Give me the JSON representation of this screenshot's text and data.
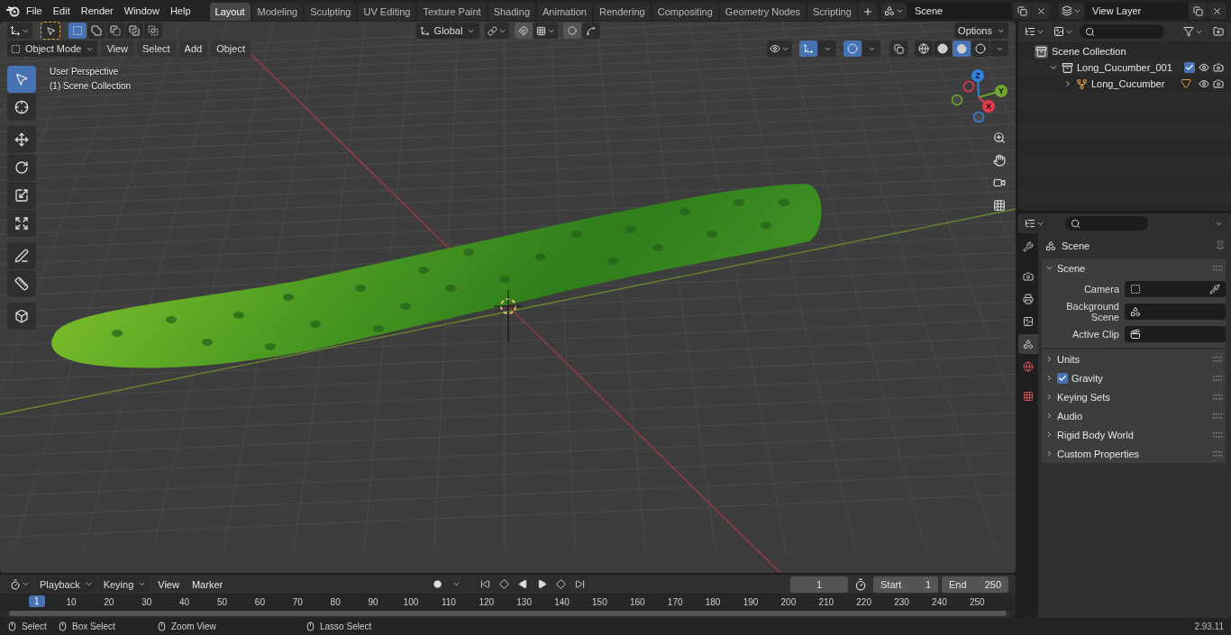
{
  "app_menu": [
    "File",
    "Edit",
    "Render",
    "Window",
    "Help"
  ],
  "workspaces": [
    {
      "label": "Layout",
      "selected": true
    },
    {
      "label": "Modeling",
      "selected": false
    },
    {
      "label": "Sculpting",
      "selected": false
    },
    {
      "label": "UV Editing",
      "selected": false
    },
    {
      "label": "Texture Paint",
      "selected": false
    },
    {
      "label": "Shading",
      "selected": false
    },
    {
      "label": "Animation",
      "selected": false
    },
    {
      "label": "Rendering",
      "selected": false
    },
    {
      "label": "Compositing",
      "selected": false
    },
    {
      "label": "Geometry Nodes",
      "selected": false
    },
    {
      "label": "Scripting",
      "selected": false
    }
  ],
  "scene_selector": {
    "value": "Scene"
  },
  "view_layer_selector": {
    "value": "View Layer"
  },
  "viewport": {
    "select_modes": [
      {
        "kind": "new",
        "selected": true
      },
      {
        "kind": "extend",
        "selected": false
      },
      {
        "kind": "subtract",
        "selected": false
      },
      {
        "kind": "invert",
        "selected": false
      },
      {
        "kind": "intersect",
        "selected": false
      }
    ],
    "orientation": "Global",
    "options": "Options",
    "mode": "Object Mode",
    "menus": [
      "View",
      "Select",
      "Add",
      "Object"
    ],
    "gizmos": {
      "on": true
    },
    "overlays": {
      "on": true
    },
    "xray": {
      "on": false
    },
    "shading": [
      {
        "kind": "wireframe",
        "selected": false
      },
      {
        "kind": "solid",
        "selected": false
      },
      {
        "kind": "material",
        "selected": true
      },
      {
        "kind": "rendered",
        "selected": false
      }
    ],
    "info": [
      "User Perspective",
      "(1) Scene Collection"
    ],
    "tools": [
      {
        "kind": "select",
        "selected": true
      },
      {
        "kind": "cursor",
        "selected": false
      },
      {
        "kind": "move",
        "selected": false
      },
      {
        "kind": "rotate",
        "selected": false
      },
      {
        "kind": "scale",
        "selected": false
      },
      {
        "kind": "transform",
        "selected": false
      },
      {
        "kind": "annotate",
        "selected": false
      },
      {
        "kind": "measure",
        "selected": false
      },
      {
        "kind": "add-cube",
        "selected": false
      }
    ],
    "gizmo": [
      {
        "label": "Z",
        "color": "#2f83e3"
      },
      {
        "label": "Y",
        "color": "#6ea72d"
      },
      {
        "label": "X",
        "color": "#e53950"
      }
    ]
  },
  "timeline": {
    "menus": [
      {
        "label": "Playback",
        "kind": "dropdown"
      },
      {
        "label": "Keying",
        "kind": "dropdown"
      },
      {
        "label": "View",
        "kind": "menu"
      },
      {
        "label": "Marker",
        "kind": "menu"
      }
    ],
    "current_frame": "1",
    "start": {
      "label": "Start",
      "value": "1"
    },
    "end": {
      "label": "End",
      "value": "250"
    },
    "ruler": [
      "10",
      "20",
      "30",
      "40",
      "50",
      "60",
      "70",
      "80",
      "90",
      "100",
      "110",
      "120",
      "130",
      "140",
      "150",
      "160",
      "170",
      "180",
      "190",
      "200",
      "210",
      "220",
      "230",
      "240",
      "250"
    ],
    "playhead": "1"
  },
  "outliner": {
    "tree": [
      {
        "label": "Scene Collection",
        "kind": "scene-collection",
        "children": [
          {
            "label": "Long_Cucumber_001",
            "kind": "collection",
            "expanded": true,
            "checked": true,
            "children": [
              {
                "label": "Long_Cucumber",
                "kind": "object",
                "expanded": false
              }
            ]
          }
        ]
      }
    ]
  },
  "properties": {
    "tabs": [
      {
        "kind": "tool",
        "selected": false
      },
      {
        "kind": "render",
        "selected": false
      },
      {
        "kind": "output",
        "selected": false
      },
      {
        "kind": "view-layer",
        "selected": false
      },
      {
        "kind": "scene",
        "selected": true
      },
      {
        "kind": "world",
        "selected": false
      },
      {
        "kind": "texture",
        "selected": false
      }
    ],
    "context": "Scene",
    "panels": [
      {
        "label": "Scene",
        "kind": "plain",
        "expanded": true,
        "fields": [
          {
            "label": "Camera",
            "kind": "camera"
          },
          {
            "label": "Background Scene",
            "kind": "scene"
          },
          {
            "label": "Active Clip",
            "kind": "clip"
          }
        ]
      },
      {
        "label": "Units",
        "kind": "plain",
        "expanded": false
      },
      {
        "label": "Gravity",
        "kind": "checkbox",
        "checked": true,
        "expanded": false
      },
      {
        "label": "Keying Sets",
        "kind": "plain",
        "expanded": false
      },
      {
        "label": "Audio",
        "kind": "plain",
        "expanded": false
      },
      {
        "label": "Rigid Body World",
        "kind": "plain",
        "expanded": false
      },
      {
        "label": "Custom Properties",
        "kind": "plain",
        "expanded": false
      }
    ]
  },
  "status_bar": {
    "hints": [
      "Select",
      "Box Select",
      "Zoom View",
      "Lasso Select"
    ],
    "version": "2.93.11"
  }
}
